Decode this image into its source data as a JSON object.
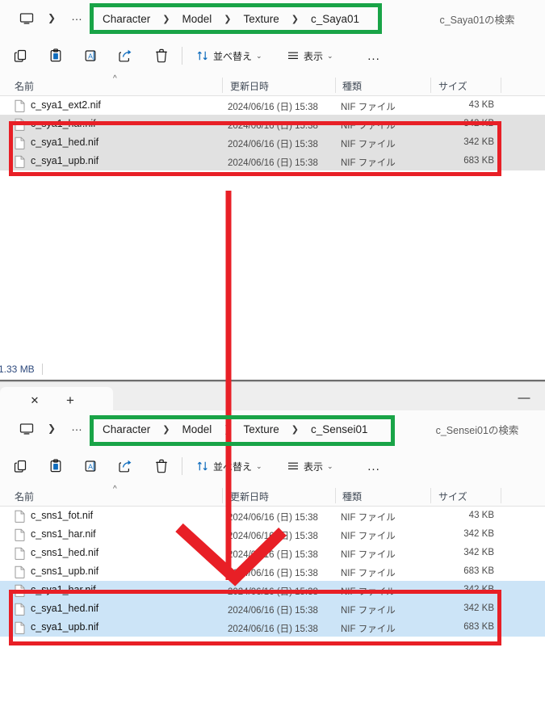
{
  "meta": {
    "app": "Windows File Explorer",
    "annotation_colors": {
      "green": "#19a447",
      "red": "#e81f26"
    }
  },
  "common": {
    "toolbar": {
      "icons": [
        {
          "name": "copy-icon",
          "label": "コピー"
        },
        {
          "name": "paste-icon",
          "label": "貼り付け"
        },
        {
          "name": "rename-icon",
          "label": "名前の変更"
        },
        {
          "name": "share-icon",
          "label": "共有"
        },
        {
          "name": "delete-icon",
          "label": "削除"
        }
      ],
      "sort_label": "並べ替え",
      "view_label": "表示",
      "more_label": "..."
    },
    "columns": [
      {
        "key": "name",
        "label": "名前"
      },
      {
        "key": "date",
        "label": "更新日時"
      },
      {
        "key": "type",
        "label": "種類"
      },
      {
        "key": "size",
        "label": "サイズ"
      }
    ],
    "breadcrumb_root_icon": "this-pc-icon",
    "breadcrumb_overflow": "…",
    "file_type": "NIF ファイル",
    "file_date": "2024/06/16 (日) 15:38"
  },
  "window_top": {
    "breadcrumb": [
      "Character",
      "Model",
      "Texture",
      "c_Saya01"
    ],
    "search_placeholder": "c_Saya01の検索",
    "files": [
      {
        "name": "c_sya1_ext2.nif",
        "date": "2024/06/16 (日) 15:38",
        "type": "NIF ファイル",
        "size": "43 KB",
        "selected": false
      },
      {
        "name": "c_sya1_har.nif",
        "date": "2024/06/16 (日) 15:38",
        "type": "NIF ファイル",
        "size": "342 KB",
        "selected": true
      },
      {
        "name": "c_sya1_hed.nif",
        "date": "2024/06/16 (日) 15:38",
        "type": "NIF ファイル",
        "size": "342 KB",
        "selected": true
      },
      {
        "name": "c_sya1_upb.nif",
        "date": "2024/06/16 (日) 15:38",
        "type": "NIF ファイル",
        "size": "683 KB",
        "selected": true
      }
    ],
    "status": "1.33 MB"
  },
  "window_bottom": {
    "tab_close_glyph": "✕",
    "tab_new_glyph": "+",
    "minimize_glyph": "—",
    "breadcrumb": [
      "Character",
      "Model",
      "Texture",
      "c_Sensei01"
    ],
    "search_placeholder": "c_Sensei01の検索",
    "files": [
      {
        "name": "c_sns1_fot.nif",
        "date": "2024/06/16 (日) 15:38",
        "type": "NIF ファイル",
        "size": "43 KB",
        "selected": false
      },
      {
        "name": "c_sns1_har.nif",
        "date": "2024/06/16 (日) 15:38",
        "type": "NIF ファイル",
        "size": "342 KB",
        "selected": false
      },
      {
        "name": "c_sns1_hed.nif",
        "date": "2024/06/16 (日) 15:38",
        "type": "NIF ファイル",
        "size": "342 KB",
        "selected": false
      },
      {
        "name": "c_sns1_upb.nif",
        "date": "2024/06/16 (日) 15:38",
        "type": "NIF ファイル",
        "size": "683 KB",
        "selected": false
      },
      {
        "name": "c_sya1_har.nif",
        "date": "2024/06/16 (日) 15:38",
        "type": "NIF ファイル",
        "size": "342 KB",
        "selected": true
      },
      {
        "name": "c_sya1_hed.nif",
        "date": "2024/06/16 (日) 15:38",
        "type": "NIF ファイル",
        "size": "342 KB",
        "selected": true
      },
      {
        "name": "c_sya1_upb.nif",
        "date": "2024/06/16 (日) 15:38",
        "type": "NIF ファイル",
        "size": "683 KB",
        "selected": true
      }
    ]
  }
}
